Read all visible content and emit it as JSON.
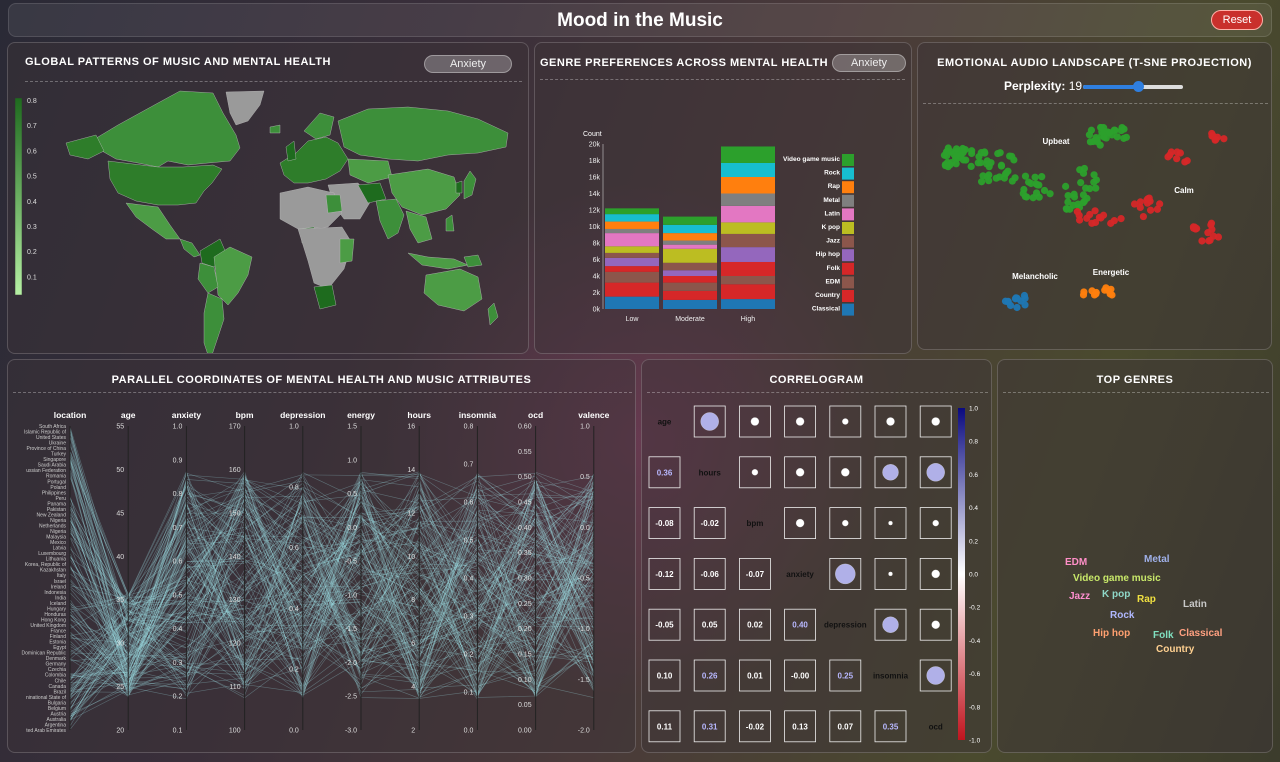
{
  "title": "Mood in the Music",
  "reset_label": "Reset",
  "map_panel": {
    "title": "GLOBAL PATTERNS OF MUSIC AND MENTAL HEALTH",
    "metric": "Anxiety",
    "legend_ticks": [
      "0.8",
      "0.7",
      "0.6",
      "0.5",
      "0.4",
      "0.3",
      "0.2",
      "0.1"
    ]
  },
  "genre_panel": {
    "title": "GENRE PREFERENCES ACROSS MENTAL HEALTH",
    "metric": "Anxiety"
  },
  "tsne_panel": {
    "title": "EMOTIONAL AUDIO LANDSCAPE (T-SNE PROJECTION)",
    "perplexity_label": "Perplexity:",
    "perplexity_value": "19",
    "perplexity_fraction": 0.55,
    "clusters": [
      {
        "label": "Upbeat",
        "color": "#2ca02c"
      },
      {
        "label": "Calm",
        "color": "#d62728"
      },
      {
        "label": "Melancholic",
        "color": "#1f77b4"
      },
      {
        "label": "Energetic",
        "color": "#ff7f0e"
      }
    ]
  },
  "parallel_panel": {
    "title": "PARALLEL COORDINATES OF MENTAL HEALTH AND MUSIC ATTRIBUTES",
    "axes": [
      {
        "name": "location",
        "ticks": []
      },
      {
        "name": "age",
        "ticks": [
          "55",
          "50",
          "45",
          "40",
          "35",
          "30",
          "25",
          "20"
        ]
      },
      {
        "name": "anxiety",
        "ticks": [
          "1.0",
          "0.9",
          "0.8",
          "0.7",
          "0.6",
          "0.5",
          "0.4",
          "0.3",
          "0.2",
          "0.1"
        ]
      },
      {
        "name": "bpm",
        "ticks": [
          "170",
          "160",
          "150",
          "140",
          "130",
          "120",
          "110",
          "100"
        ]
      },
      {
        "name": "depression",
        "ticks": [
          "1.0",
          "0.8",
          "0.6",
          "0.4",
          "0.2",
          "0.0"
        ]
      },
      {
        "name": "energy",
        "ticks": [
          "1.5",
          "1.0",
          "0.5",
          "0.0",
          "-0.5",
          "-1.0",
          "-1.5",
          "-2.0",
          "-2.5",
          "-3.0"
        ]
      },
      {
        "name": "hours",
        "ticks": [
          "16",
          "14",
          "12",
          "10",
          "8",
          "6",
          "4",
          "2"
        ]
      },
      {
        "name": "insomnia",
        "ticks": [
          "0.8",
          "0.7",
          "0.6",
          "0.5",
          "0.4",
          "0.3",
          "0.2",
          "0.1",
          "0.0"
        ]
      },
      {
        "name": "ocd",
        "ticks": [
          "0.60",
          "0.55",
          "0.50",
          "0.45",
          "0.40",
          "0.35",
          "0.30",
          "0.25",
          "0.20",
          "0.15",
          "0.10",
          "0.05",
          "0.00"
        ]
      },
      {
        "name": "valence",
        "ticks": [
          "1.0",
          "0.5",
          "0.0",
          "-0.5",
          "-1.0",
          "-1.5",
          "-2.0"
        ]
      }
    ],
    "locations": [
      "South Africa",
      "Islamic Republic of",
      "United States",
      "Ukraine",
      "Province of China",
      "Turkey",
      "Singapore",
      "Saudi Arabia",
      "ussian Federation",
      "Romania",
      "Portugal",
      "Poland",
      "Philippines",
      "Peru",
      "Panama",
      "Pakistan",
      "New Zealand",
      "Nigeria",
      "Netherlands",
      "Nigeria",
      "Malaysia",
      "Mexico",
      "Latvia",
      "Luxembourg",
      "Lithuania",
      "Korea, Republic of",
      "Kazakhstan",
      "Italy",
      "Israel",
      "Ireland",
      "Indonesia",
      "India",
      "Iceland",
      "Hungary",
      "Honduras",
      "Hong Kong",
      "United Kingdom",
      "France",
      "Finland",
      "Estonia",
      "Egypt",
      "Dominican Republic",
      "Denmark",
      "Germany",
      "Czechia",
      "Colombia",
      "Chile",
      "Canada",
      "Brazil",
      "ninational State of",
      "Bulgaria",
      "Belgium",
      "Austria",
      "Australia",
      "Argentina",
      "ted Arab Emirates"
    ]
  },
  "correlogram_panel": {
    "title": "CORRELOGRAM",
    "variables": [
      "age",
      "hours",
      "bpm",
      "anxiety",
      "depression",
      "insomnia",
      "ocd"
    ],
    "lower": [
      [
        "0.36"
      ],
      [
        "-0.08",
        "-0.02"
      ],
      [
        "-0.12",
        "-0.06",
        "-0.07"
      ],
      [
        "-0.05",
        "0.05",
        "0.02",
        "0.40"
      ],
      [
        "0.10",
        "0.26",
        "0.01",
        "-0.00",
        "0.25"
      ],
      [
        "0.11",
        "0.31",
        "-0.02",
        "0.13",
        "0.07",
        "0.35"
      ]
    ],
    "colorbar_ticks": [
      "1.0",
      "0.8",
      "0.6",
      "0.4",
      "0.2",
      "0.0",
      "-0.2",
      "-0.4",
      "-0.6",
      "-0.8",
      "-1.0"
    ]
  },
  "top_genres_panel": {
    "title": "TOP GENRES",
    "words": [
      {
        "text": "EDM",
        "color": "#ff8fc8"
      },
      {
        "text": "Metal",
        "color": "#9fb0e8"
      },
      {
        "text": "Video game music",
        "color": "#c8e86a"
      },
      {
        "text": "Jazz",
        "color": "#ff8fd0"
      },
      {
        "text": "K pop",
        "color": "#8fd8c8"
      },
      {
        "text": "Rap",
        "color": "#f0e040"
      },
      {
        "text": "Latin",
        "color": "#c8c8c8"
      },
      {
        "text": "Rock",
        "color": "#b0b8ff"
      },
      {
        "text": "Hip hop",
        "color": "#ffa070"
      },
      {
        "text": "Folk",
        "color": "#80e0c0"
      },
      {
        "text": "Classical",
        "color": "#ffa080"
      },
      {
        "text": "Country",
        "color": "#ffd090"
      }
    ]
  },
  "chart_data": {
    "type": "bar",
    "stacked": true,
    "ylabel": "Count",
    "categories": [
      "Low",
      "Moderate",
      "High"
    ],
    "ylim": [
      0,
      20000
    ],
    "yticks": [
      "0k",
      "2k",
      "4k",
      "6k",
      "8k",
      "10k",
      "12k",
      "14k",
      "16k",
      "18k",
      "20k"
    ],
    "legend_placement": "right",
    "series": [
      {
        "name": "Classical",
        "color": "#1f77b4",
        "values": [
          1500,
          1100,
          1200
        ]
      },
      {
        "name": "Country",
        "color": "#d62728",
        "values": [
          1700,
          1100,
          1800
        ]
      },
      {
        "name": "EDM",
        "color": "#8c564b",
        "values": [
          1300,
          1000,
          1000
        ]
      },
      {
        "name": "Folk",
        "color": "#d62728",
        "values": [
          700,
          800,
          1700
        ]
      },
      {
        "name": "Hip hop",
        "color": "#9467bd",
        "values": [
          1000,
          700,
          1800
        ]
      },
      {
        "name": "Jazz",
        "color": "#8c564b",
        "values": [
          600,
          900,
          1600
        ]
      },
      {
        "name": "K pop",
        "color": "#bcbd22",
        "values": [
          800,
          1700,
          1400
        ]
      },
      {
        "name": "Latin",
        "color": "#e377c2",
        "values": [
          1600,
          500,
          2000
        ]
      },
      {
        "name": "Metal",
        "color": "#7f7f7f",
        "values": [
          500,
          500,
          1500
        ]
      },
      {
        "name": "Rap",
        "color": "#ff7f0e",
        "values": [
          900,
          900,
          2000
        ]
      },
      {
        "name": "Rock",
        "color": "#17becf",
        "values": [
          900,
          1000,
          1700
        ]
      },
      {
        "name": "Video game music",
        "color": "#2ca02c",
        "values": [
          700,
          1000,
          2000
        ]
      }
    ]
  }
}
